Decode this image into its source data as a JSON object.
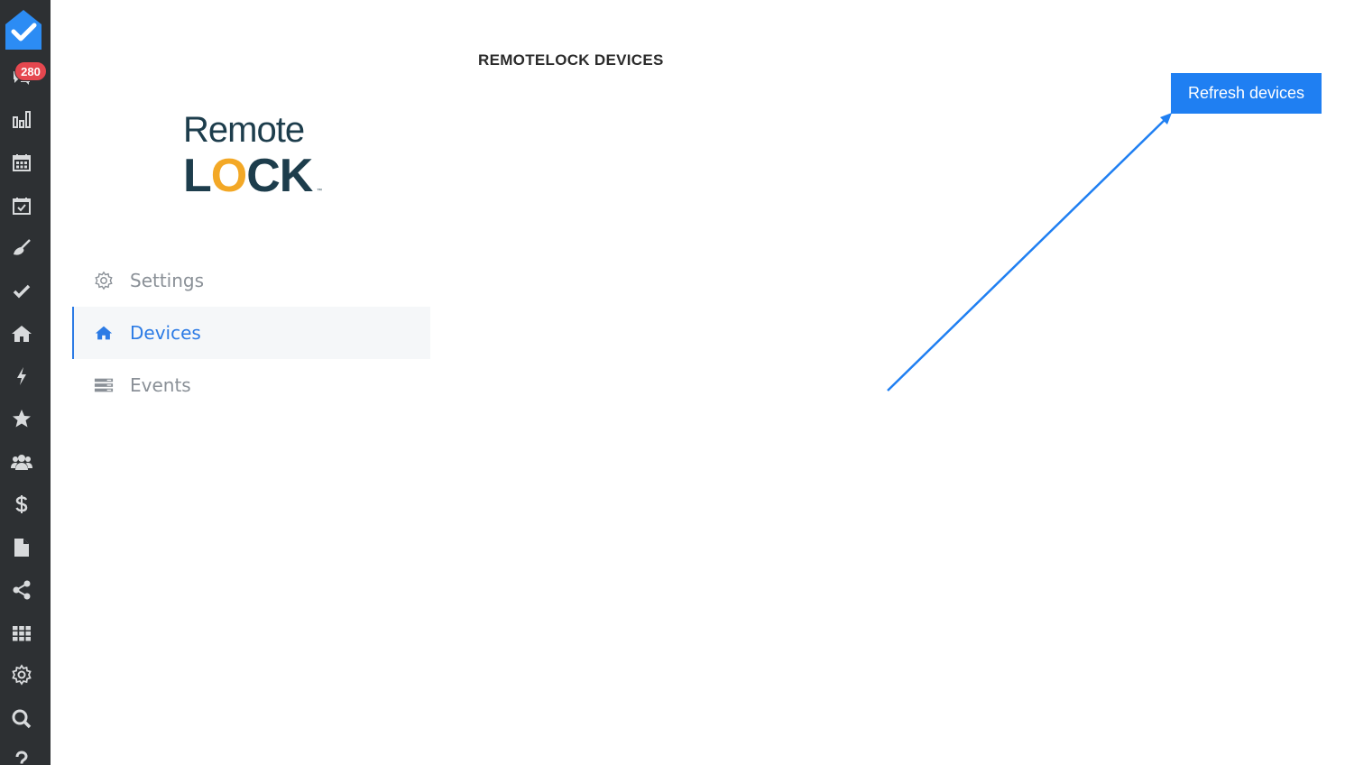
{
  "rail": {
    "notification_count": "280",
    "icons": [
      "app-logo-icon",
      "chat-icon",
      "bar-chart-icon",
      "calendar-icon",
      "calendar-check-icon",
      "broom-icon",
      "check-icon",
      "home-icon",
      "bolt-icon",
      "star-icon",
      "users-icon",
      "dollar-icon",
      "file-icon",
      "share-icon",
      "grid-icon",
      "gear-icon",
      "search-icon",
      "help-icon"
    ]
  },
  "brand": {
    "line1": "Remote",
    "line2": "LOCK",
    "colors": {
      "text": "#1d3d4c",
      "accent": "#f3a826"
    }
  },
  "nav": {
    "items": [
      {
        "label": "Settings",
        "icon": "gear-icon",
        "active": false
      },
      {
        "label": "Devices",
        "icon": "home-icon",
        "active": true
      },
      {
        "label": "Events",
        "icon": "server-icon",
        "active": false
      }
    ]
  },
  "main": {
    "title": "REMOTELOCK DEVICES",
    "refresh_label": "Refresh devices"
  },
  "colors": {
    "accent": "#1f7ff2",
    "rail": "#2d3033",
    "badge": "#e5474f"
  }
}
